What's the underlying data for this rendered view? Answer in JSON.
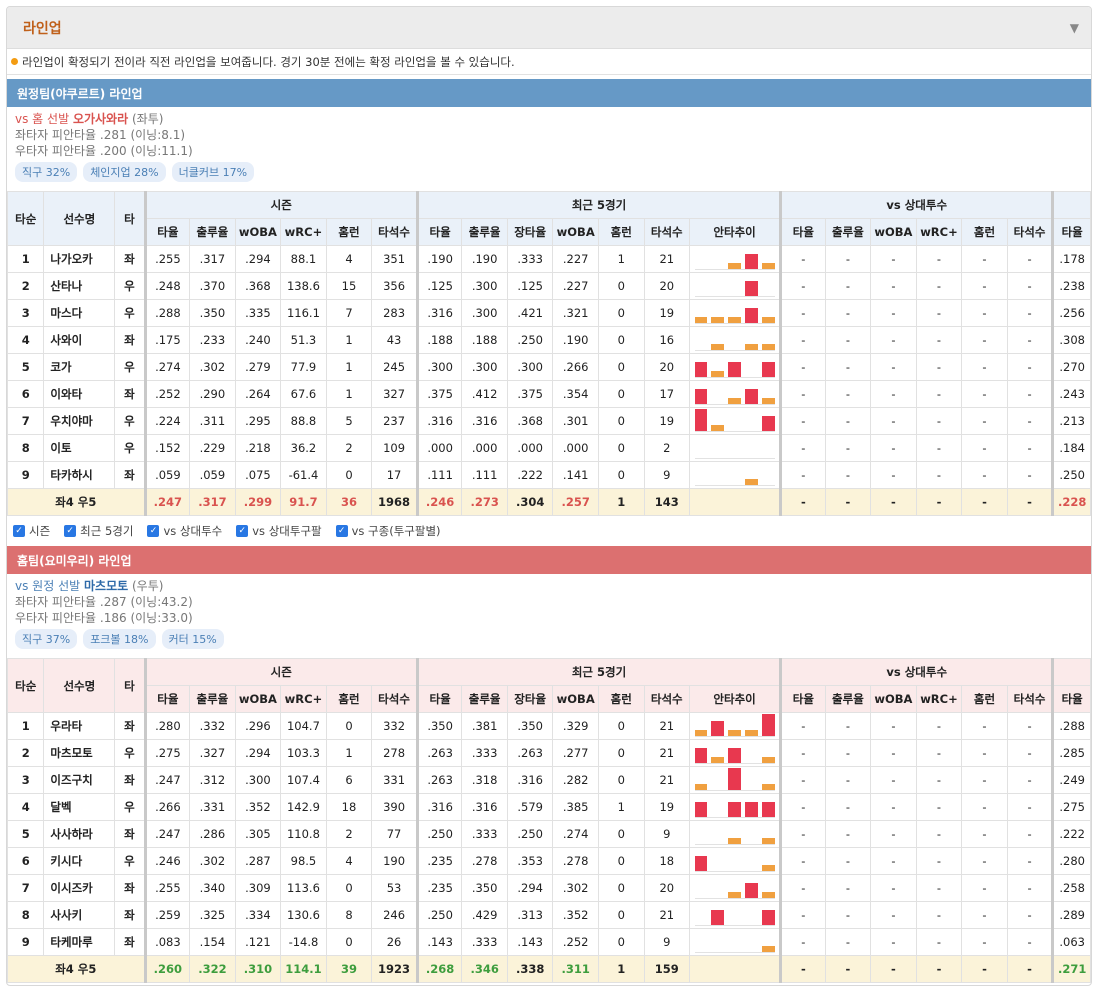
{
  "panel": {
    "title": "라인업",
    "caret_icon": "triangle-down-icon"
  },
  "notice": "라인업이 확정되기 전이라 직전 라인업을 보여줍니다. 경기 30분 전에는 확정 라인업을 볼 수 있습니다.",
  "headers": {
    "order": "타순",
    "player": "선수명",
    "hand": "타",
    "season": "시즌",
    "recent": "최근 5경기",
    "vspitcher": "vs 상대투수",
    "cols_season": [
      "타율",
      "출루율",
      "wOBA",
      "wRC+",
      "홈런",
      "타석수"
    ],
    "cols_recent": [
      "타율",
      "출루율",
      "장타율",
      "wOBA",
      "홈런",
      "타석수",
      "안타추이"
    ],
    "cols_vs": [
      "타율",
      "출루율",
      "wOBA",
      "wRC+",
      "홈런",
      "타석수"
    ],
    "cols_extra": [
      "타율"
    ]
  },
  "checkboxes": [
    "시즌",
    "최근 5경기",
    "vs 상대투수",
    "vs 상대투구팔",
    "vs 구종(투구팔별)"
  ],
  "away": {
    "bar": "원정팀(야쿠르트) 라인업",
    "vs_prefix": "vs 홈 선발",
    "pitcher": "오가사와라",
    "pitcher_hand": "(좌투)",
    "line1": "좌타자 피안타율 .281 (이닝:8.1)",
    "line2": "우타자 피안타율 .200 (이닝:11.1)",
    "chips": [
      "직구 32%",
      "체인지업 28%",
      "너클커브 17%"
    ],
    "rows": [
      {
        "o": "1",
        "n": "나가오카",
        "h": "좌",
        "s": [
          ".255",
          ".317",
          ".294",
          "88.1",
          "4",
          "351"
        ],
        "r": [
          ".190",
          ".190",
          ".333",
          ".227",
          "1",
          "21"
        ],
        "spark": [
          0,
          0,
          1,
          2,
          1
        ],
        "v": [
          "-",
          "-",
          "-",
          "-",
          "-",
          "-"
        ],
        "x": ".178"
      },
      {
        "o": "2",
        "n": "산타나",
        "h": "우",
        "s": [
          ".248",
          ".370",
          ".368",
          "138.6",
          "15",
          "356"
        ],
        "r": [
          ".125",
          ".300",
          ".125",
          ".227",
          "0",
          "20"
        ],
        "spark": [
          0,
          0,
          0,
          2,
          0
        ],
        "v": [
          "-",
          "-",
          "-",
          "-",
          "-",
          "-"
        ],
        "x": ".238"
      },
      {
        "o": "3",
        "n": "마스다",
        "h": "우",
        "s": [
          ".288",
          ".350",
          ".335",
          "116.1",
          "7",
          "283"
        ],
        "r": [
          ".316",
          ".300",
          ".421",
          ".321",
          "0",
          "19"
        ],
        "spark": [
          1,
          1,
          1,
          2,
          1
        ],
        "v": [
          "-",
          "-",
          "-",
          "-",
          "-",
          "-"
        ],
        "x": ".256"
      },
      {
        "o": "4",
        "n": "사와이",
        "h": "좌",
        "s": [
          ".175",
          ".233",
          ".240",
          "51.3",
          "1",
          "43"
        ],
        "r": [
          ".188",
          ".188",
          ".250",
          ".190",
          "0",
          "16"
        ],
        "spark": [
          0,
          1,
          0,
          1,
          1
        ],
        "v": [
          "-",
          "-",
          "-",
          "-",
          "-",
          "-"
        ],
        "x": ".308"
      },
      {
        "o": "5",
        "n": "코가",
        "h": "우",
        "s": [
          ".274",
          ".302",
          ".279",
          "77.9",
          "1",
          "245"
        ],
        "r": [
          ".300",
          ".300",
          ".300",
          ".266",
          "0",
          "20"
        ],
        "spark": [
          2,
          1,
          2,
          0,
          2
        ],
        "v": [
          "-",
          "-",
          "-",
          "-",
          "-",
          "-"
        ],
        "x": ".270"
      },
      {
        "o": "6",
        "n": "이와타",
        "h": "좌",
        "s": [
          ".252",
          ".290",
          ".264",
          "67.6",
          "1",
          "327"
        ],
        "r": [
          ".375",
          ".412",
          ".375",
          ".354",
          "0",
          "17"
        ],
        "spark": [
          2,
          0,
          1,
          2,
          1
        ],
        "v": [
          "-",
          "-",
          "-",
          "-",
          "-",
          "-"
        ],
        "x": ".243"
      },
      {
        "o": "7",
        "n": "우치야마",
        "h": "우",
        "s": [
          ".224",
          ".311",
          ".295",
          "88.8",
          "5",
          "237"
        ],
        "r": [
          ".316",
          ".316",
          ".368",
          ".301",
          "0",
          "19"
        ],
        "spark": [
          3,
          1,
          0,
          0,
          2
        ],
        "v": [
          "-",
          "-",
          "-",
          "-",
          "-",
          "-"
        ],
        "x": ".213"
      },
      {
        "o": "8",
        "n": "이토",
        "h": "우",
        "s": [
          ".152",
          ".229",
          ".218",
          "36.2",
          "2",
          "109"
        ],
        "r": [
          ".000",
          ".000",
          ".000",
          ".000",
          "0",
          "2"
        ],
        "spark": [
          0,
          0,
          0,
          0,
          0
        ],
        "v": [
          "-",
          "-",
          "-",
          "-",
          "-",
          "-"
        ],
        "x": ".184"
      },
      {
        "o": "9",
        "n": "타카하시",
        "h": "좌",
        "s": [
          ".059",
          ".059",
          ".075",
          "-61.4",
          "0",
          "17"
        ],
        "r": [
          ".111",
          ".111",
          ".222",
          ".141",
          "0",
          "9"
        ],
        "spark": [
          0,
          0,
          0,
          1,
          0
        ],
        "v": [
          "-",
          "-",
          "-",
          "-",
          "-",
          "-"
        ],
        "x": ".250"
      }
    ],
    "total": {
      "label": "좌4 우5",
      "s": [
        ".247",
        ".317",
        ".299",
        "91.7",
        "36",
        "1968"
      ],
      "r": [
        ".246",
        ".273",
        ".304",
        ".257",
        "1",
        "143"
      ],
      "v": [
        "-",
        "-",
        "-",
        "-",
        "-",
        "-"
      ],
      "x": ".228"
    }
  },
  "home": {
    "bar": "홈팀(요미우리) 라인업",
    "vs_prefix": "vs 원정 선발",
    "pitcher": "마츠모토",
    "pitcher_hand": "(우투)",
    "line1": "좌타자 피안타율 .287 (이닝:43.2)",
    "line2": "우타자 피안타율 .186 (이닝:33.0)",
    "chips": [
      "직구 37%",
      "포크볼 18%",
      "커터 15%"
    ],
    "rows": [
      {
        "o": "1",
        "n": "우라타",
        "h": "좌",
        "s": [
          ".280",
          ".332",
          ".296",
          "104.7",
          "0",
          "332"
        ],
        "r": [
          ".350",
          ".381",
          ".350",
          ".329",
          "0",
          "21"
        ],
        "spark": [
          1,
          2,
          1,
          1,
          3
        ],
        "v": [
          "-",
          "-",
          "-",
          "-",
          "-",
          "-"
        ],
        "x": ".288"
      },
      {
        "o": "2",
        "n": "마츠모토",
        "h": "우",
        "s": [
          ".275",
          ".327",
          ".294",
          "103.3",
          "1",
          "278"
        ],
        "r": [
          ".263",
          ".333",
          ".263",
          ".277",
          "0",
          "21"
        ],
        "spark": [
          2,
          1,
          2,
          0,
          1
        ],
        "v": [
          "-",
          "-",
          "-",
          "-",
          "-",
          "-"
        ],
        "x": ".285"
      },
      {
        "o": "3",
        "n": "이즈구치",
        "h": "좌",
        "s": [
          ".247",
          ".312",
          ".300",
          "107.4",
          "6",
          "331"
        ],
        "r": [
          ".263",
          ".318",
          ".316",
          ".282",
          "0",
          "21"
        ],
        "spark": [
          1,
          0,
          3,
          0,
          1
        ],
        "v": [
          "-",
          "-",
          "-",
          "-",
          "-",
          "-"
        ],
        "x": ".249"
      },
      {
        "o": "4",
        "n": "달벡",
        "h": "우",
        "s": [
          ".266",
          ".331",
          ".352",
          "142.9",
          "18",
          "390"
        ],
        "r": [
          ".316",
          ".316",
          ".579",
          ".385",
          "1",
          "19"
        ],
        "spark": [
          2,
          0,
          2,
          2,
          2
        ],
        "v": [
          "-",
          "-",
          "-",
          "-",
          "-",
          "-"
        ],
        "x": ".275"
      },
      {
        "o": "5",
        "n": "사사하라",
        "h": "좌",
        "s": [
          ".247",
          ".286",
          ".305",
          "110.8",
          "2",
          "77"
        ],
        "r": [
          ".250",
          ".333",
          ".250",
          ".274",
          "0",
          "9"
        ],
        "spark": [
          0,
          0,
          1,
          0,
          1
        ],
        "v": [
          "-",
          "-",
          "-",
          "-",
          "-",
          "-"
        ],
        "x": ".222"
      },
      {
        "o": "6",
        "n": "키시다",
        "h": "우",
        "s": [
          ".246",
          ".302",
          ".287",
          "98.5",
          "4",
          "190"
        ],
        "r": [
          ".235",
          ".278",
          ".353",
          ".278",
          "0",
          "18"
        ],
        "spark": [
          2,
          0,
          0,
          0,
          1
        ],
        "v": [
          "-",
          "-",
          "-",
          "-",
          "-",
          "-"
        ],
        "x": ".280"
      },
      {
        "o": "7",
        "n": "이시즈카",
        "h": "좌",
        "s": [
          ".255",
          ".340",
          ".309",
          "113.6",
          "0",
          "53"
        ],
        "r": [
          ".235",
          ".350",
          ".294",
          ".302",
          "0",
          "20"
        ],
        "spark": [
          0,
          0,
          1,
          2,
          1
        ],
        "v": [
          "-",
          "-",
          "-",
          "-",
          "-",
          "-"
        ],
        "x": ".258"
      },
      {
        "o": "8",
        "n": "사사키",
        "h": "좌",
        "s": [
          ".259",
          ".325",
          ".334",
          "130.6",
          "8",
          "246"
        ],
        "r": [
          ".250",
          ".429",
          ".313",
          ".352",
          "0",
          "21"
        ],
        "spark": [
          0,
          2,
          0,
          0,
          2
        ],
        "v": [
          "-",
          "-",
          "-",
          "-",
          "-",
          "-"
        ],
        "x": ".289"
      },
      {
        "o": "9",
        "n": "타케마루",
        "h": "좌",
        "s": [
          ".083",
          ".154",
          ".121",
          "-14.8",
          "0",
          "26"
        ],
        "r": [
          ".143",
          ".333",
          ".143",
          ".252",
          "0",
          "9"
        ],
        "spark": [
          0,
          0,
          0,
          0,
          1
        ],
        "v": [
          "-",
          "-",
          "-",
          "-",
          "-",
          "-"
        ],
        "x": ".063"
      }
    ],
    "total": {
      "label": "좌4 우5",
      "s": [
        ".260",
        ".322",
        ".310",
        "114.1",
        "39",
        "1923"
      ],
      "r": [
        ".268",
        ".346",
        ".338",
        ".311",
        "1",
        "159"
      ],
      "v": [
        "-",
        "-",
        "-",
        "-",
        "-",
        "-"
      ],
      "x": ".271"
    }
  },
  "colors": {
    "away_bar": "#6699c6",
    "home_bar": "#dc7070",
    "spark_hit": "#e8384f",
    "spark_low": "#f0a040",
    "total_bg": "#fbf3d9"
  }
}
